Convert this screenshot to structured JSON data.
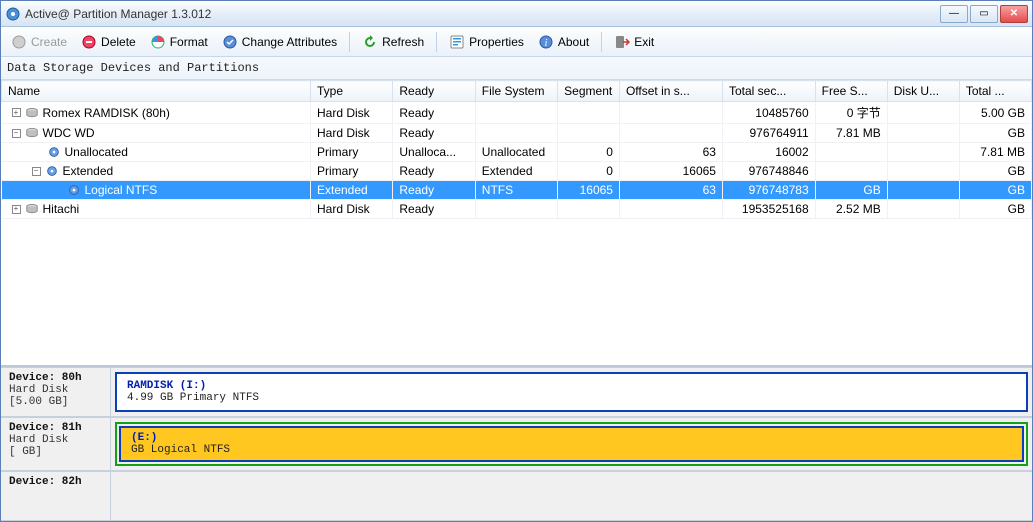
{
  "window": {
    "title": "Active@ Partition Manager 1.3.012"
  },
  "toolbar": {
    "create": "Create",
    "delete": "Delete",
    "format": "Format",
    "change_attr": "Change Attributes",
    "refresh": "Refresh",
    "properties": "Properties",
    "about": "About",
    "exit": "Exit"
  },
  "pane_label": "Data Storage Devices and Partitions",
  "columns": {
    "name": "Name",
    "type": "Type",
    "ready": "Ready",
    "file_system": "File System",
    "segment": "Segment",
    "offset": "Offset in s...",
    "total_sec": "Total sec...",
    "free_s": "Free S...",
    "disk_u": "Disk U...",
    "total": "Total ..."
  },
  "rows": [
    {
      "indent": 0,
      "expander": "+",
      "icon": "disk",
      "name": "Romex RAMDISK (80h)",
      "type": "Hard Disk",
      "ready": "Ready",
      "fs": "",
      "seg": "",
      "offset": "",
      "totalsec": "10485760",
      "free": "0 字节",
      "disku": "",
      "total": "5.00 GB",
      "selected": false
    },
    {
      "indent": 0,
      "expander": "-",
      "icon": "disk",
      "name": "WDC WD",
      "type": "Hard Disk",
      "ready": "Ready",
      "fs": "",
      "seg": "",
      "offset": "",
      "totalsec": "976764911",
      "free": "7.81 MB",
      "disku": "",
      "total": "GB",
      "selected": false
    },
    {
      "indent": 1,
      "expander": "",
      "icon": "part",
      "name": "Unallocated",
      "type": "Primary",
      "ready": "Unalloca...",
      "fs": "Unallocated",
      "seg": "0",
      "offset": "63",
      "totalsec": "16002",
      "free": "",
      "disku": "",
      "total": "7.81 MB",
      "selected": false
    },
    {
      "indent": 1,
      "expander": "-",
      "icon": "part",
      "name": "Extended",
      "type": "Primary",
      "ready": "Ready",
      "fs": "Extended",
      "seg": "0",
      "offset": "16065",
      "totalsec": "976748846",
      "free": "",
      "disku": "",
      "total": "GB",
      "selected": false
    },
    {
      "indent": 2,
      "expander": "",
      "icon": "part",
      "name": "Logical NTFS",
      "type": "Extended",
      "ready": "Ready",
      "fs": "NTFS",
      "seg": "16065",
      "offset": "63",
      "totalsec": "976748783",
      "free": "GB",
      "disku": "",
      "total": "GB",
      "selected": true
    },
    {
      "indent": 0,
      "expander": "+",
      "icon": "disk",
      "name": "Hitachi",
      "type": "Hard Disk",
      "ready": "Ready",
      "fs": "",
      "seg": "",
      "offset": "",
      "totalsec": "1953525168",
      "free": "2.52 MB",
      "disku": "",
      "total": "GB",
      "selected": false
    }
  ],
  "devices": [
    {
      "id": "80h",
      "title": "Device: 80h",
      "sub1": "Hard Disk",
      "sub2": "[5.00 GB]",
      "parts": [
        {
          "kind": "ramdisk",
          "title": "RAMDISK (I:)",
          "sub": "4.99 GB Primary NTFS"
        }
      ]
    },
    {
      "id": "81h",
      "title": "Device: 81h",
      "sub1": "Hard Disk",
      "sub2": "[   GB]",
      "parts": [
        {
          "kind": "extended",
          "inner": {
            "kind": "logical",
            "title": "(E:)",
            "sub": "GB Logical NTFS"
          }
        }
      ]
    },
    {
      "id": "82h",
      "title": "Device: 82h",
      "sub1": "",
      "sub2": "",
      "parts": []
    }
  ]
}
